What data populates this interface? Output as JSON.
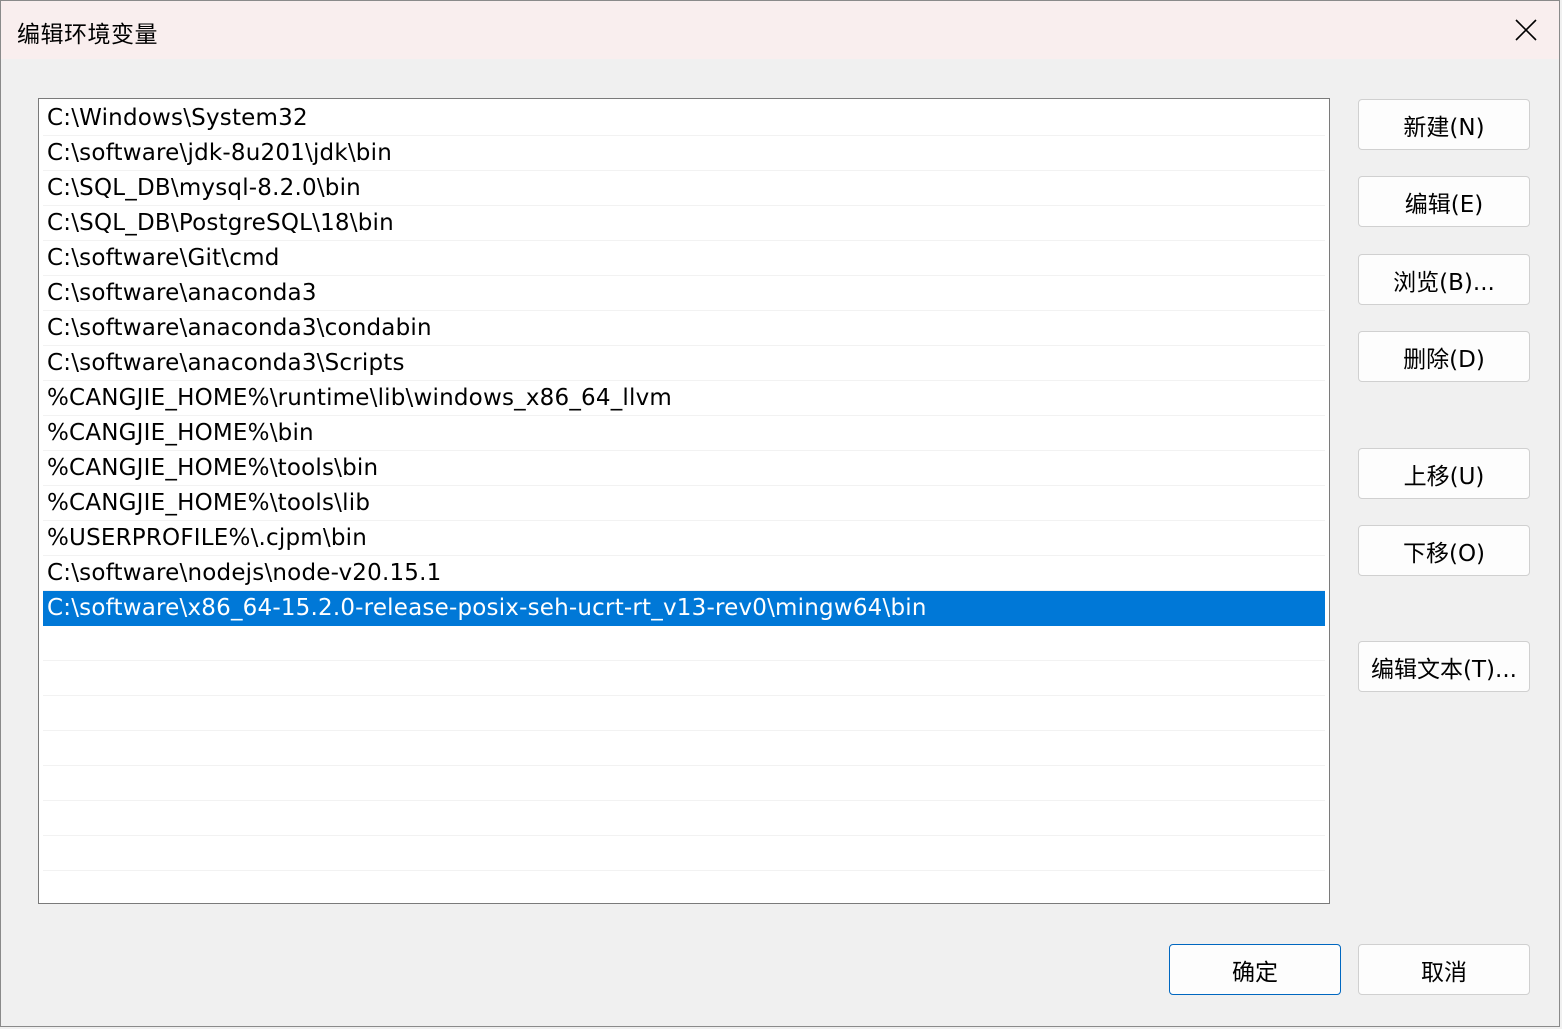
{
  "window": {
    "title": "编辑环境变量"
  },
  "paths": [
    "C:\\Windows\\System32",
    "C:\\software\\jdk-8u201\\jdk\\bin",
    "C:\\SQL_DB\\mysql-8.2.0\\bin",
    "C:\\SQL_DB\\PostgreSQL\\18\\bin",
    "C:\\software\\Git\\cmd",
    "C:\\software\\anaconda3",
    "C:\\software\\anaconda3\\condabin",
    "C:\\software\\anaconda3\\Scripts",
    "%CANGJIE_HOME%\\runtime\\lib\\windows_x86_64_llvm",
    "%CANGJIE_HOME%\\bin",
    "%CANGJIE_HOME%\\tools\\bin",
    "%CANGJIE_HOME%\\tools\\lib",
    "%USERPROFILE%\\.cjpm\\bin",
    "C:\\software\\nodejs\\node-v20.15.1",
    "C:\\software\\x86_64-15.2.0-release-posix-seh-ucrt-rt_v13-rev0\\mingw64\\bin"
  ],
  "selected_index": 14,
  "buttons": {
    "new": "新建(N)",
    "edit": "编辑(E)",
    "browse": "浏览(B)...",
    "delete": "删除(D)",
    "move_up": "上移(U)",
    "move_down": "下移(O)",
    "edit_text": "编辑文本(T)...",
    "ok": "确定",
    "cancel": "取消"
  },
  "colors": {
    "selection": "#0078d7",
    "titlebar": "#f9eeee"
  }
}
